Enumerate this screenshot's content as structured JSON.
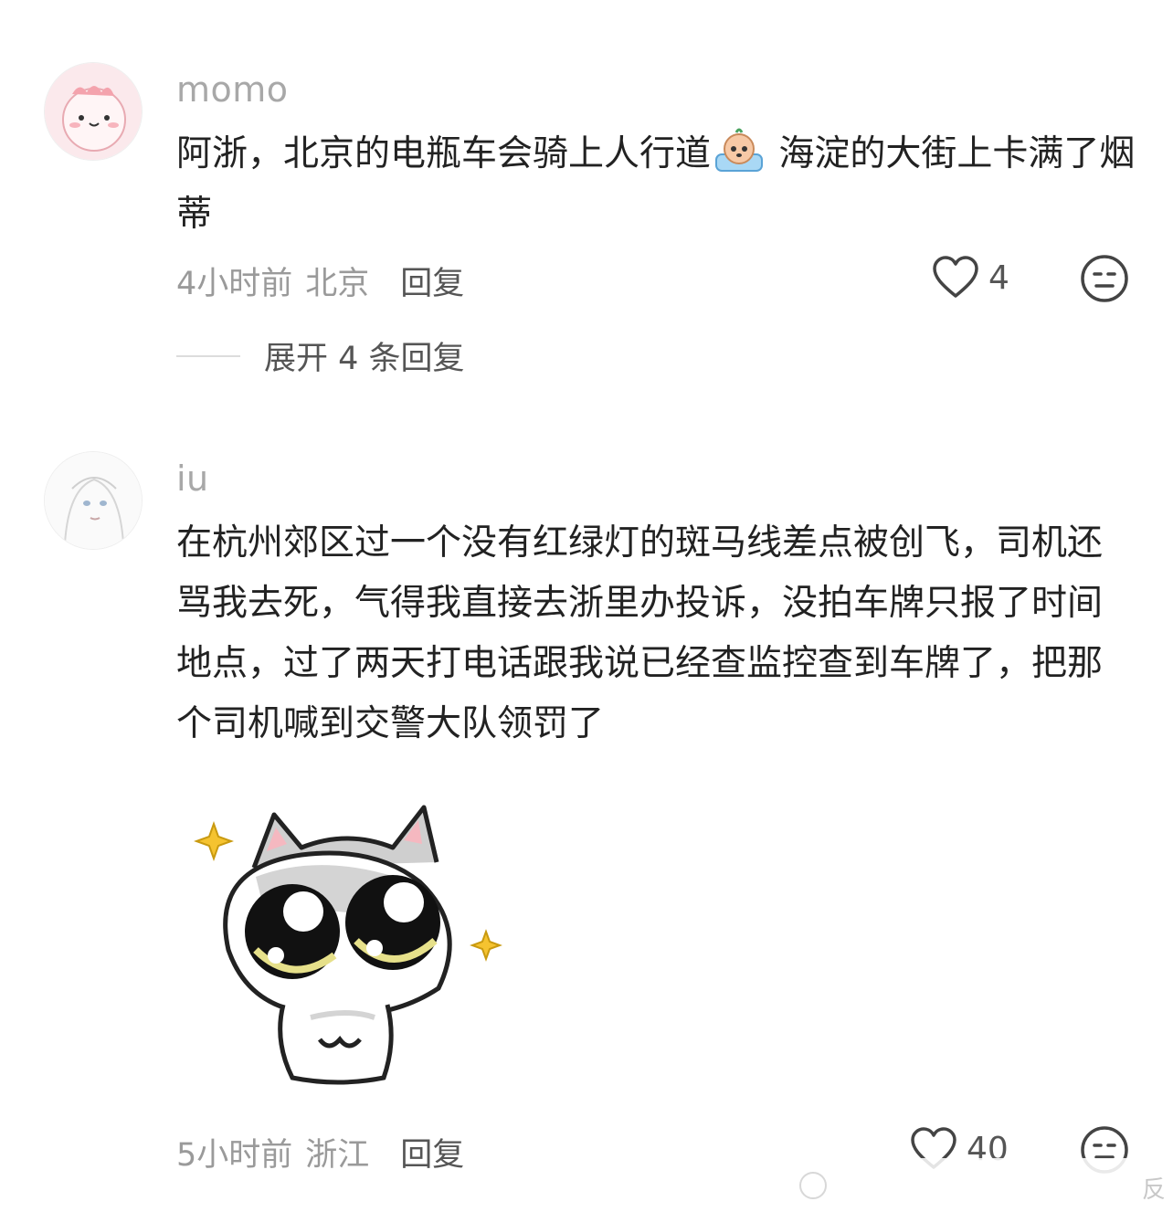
{
  "comments": [
    {
      "username": "momo",
      "text_before_emoji": "阿浙，北京的电瓶车会骑上人行道",
      "inline_emoji": "crying-face-emoji",
      "text_after_emoji": "海淀的大街上卡满了烟蒂",
      "time": "4小时前",
      "location": "北京",
      "reply_label": "回复",
      "likes": "4",
      "expand_label": "展开 4 条回复"
    },
    {
      "username": "iu",
      "text": "在杭州郊区过一个没有红绿灯的斑马线差点被创飞，司机还骂我去死，气得我直接去浙里办投诉，没拍车牌只报了时间地点，过了两天打电话跟我说已经查监控查到车牌了，把那个司机喊到交警大队领罚了",
      "sticker": "cat-sticker",
      "time": "5小时前",
      "location": "浙江",
      "reply_label": "回复",
      "likes": "40"
    }
  ],
  "watermark": {
    "text": "反"
  },
  "colors": {
    "muted": "#9a9a9a",
    "username": "#a8a8a8",
    "text": "#222222"
  }
}
